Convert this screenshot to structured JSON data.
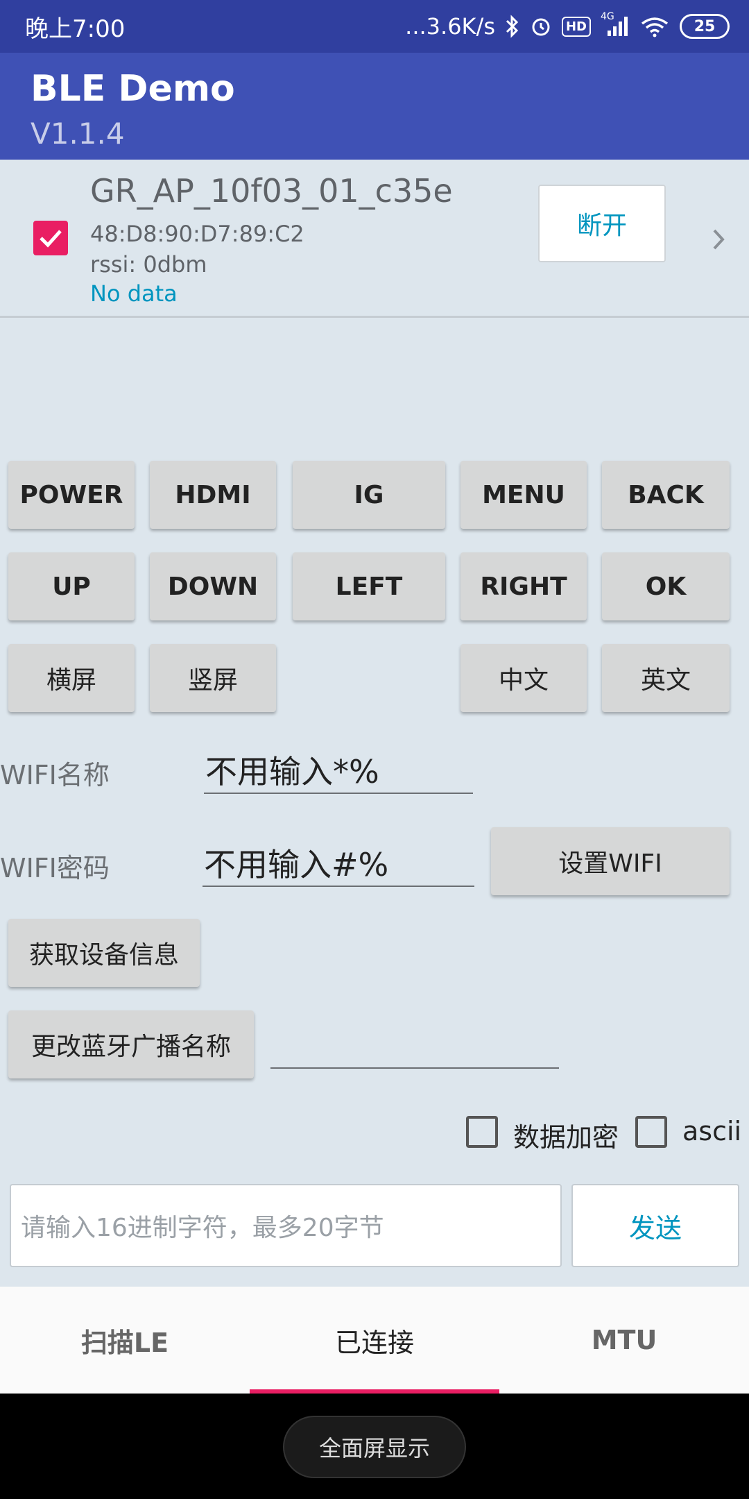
{
  "status_bar": {
    "time": "晚上7:00",
    "network_speed": "...3.6K/s",
    "hd_badge": "HD",
    "signal_label": "4G",
    "battery": "25"
  },
  "app_bar": {
    "title": "BLE Demo",
    "version": "V1.1.4"
  },
  "device": {
    "name": "GR_AP_10f03_01_c35e",
    "mac": "48:D8:90:D7:89:C2",
    "rssi": "rssi: 0dbm",
    "data": "No data",
    "checked": true,
    "disconnect_label": "断开"
  },
  "remote": {
    "row1": [
      "POWER",
      "HDMI",
      "IG",
      "MENU",
      "BACK"
    ],
    "row2": [
      "UP",
      "DOWN",
      "LEFT",
      "RIGHT",
      "OK"
    ],
    "row3": [
      "横屏",
      "竖屏",
      "中文",
      "英文"
    ]
  },
  "wifi": {
    "name_label": "WIFI名称",
    "name_value": "不用输入*%",
    "password_label": "WIFI密码",
    "password_value": "不用输入#%",
    "set_wifi_label": "设置WIFI"
  },
  "actions": {
    "get_device_info": "获取设备信息",
    "change_ble_name": "更改蓝牙广播名称",
    "ble_name_value": ""
  },
  "options": {
    "encrypt_label": "数据加密",
    "ascii_label": "ascii"
  },
  "send": {
    "placeholder": "请输入16进制字符，最多20字节",
    "send_label": "发送"
  },
  "tabs": [
    {
      "label": "扫描LE",
      "active": false
    },
    {
      "label": "已连接",
      "active": true
    },
    {
      "label": "MTU",
      "active": false
    }
  ],
  "nav": {
    "fullscreen_label": "全面屏显示"
  },
  "colors": {
    "status_bar": "#303f9f",
    "app_bar": "#3f51b5",
    "accent": "#e91e63",
    "link": "#0095bf",
    "background": "#dde6ed"
  }
}
